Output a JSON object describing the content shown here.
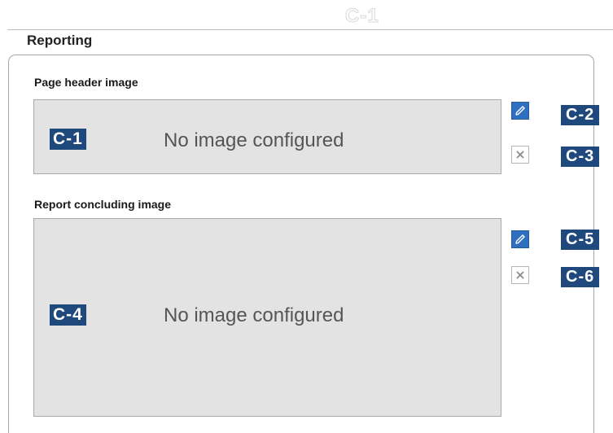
{
  "ghost_callout": "C-1",
  "section": {
    "title": "Reporting"
  },
  "page_header": {
    "label": "Page header image",
    "placeholder": "No image configured",
    "callouts": {
      "box": "C-1",
      "edit": "C-2",
      "remove": "C-3"
    }
  },
  "report_concluding": {
    "label": "Report concluding image",
    "placeholder": "No image configured",
    "callouts": {
      "box": "C-4",
      "edit": "C-5",
      "remove": "C-6"
    }
  },
  "icons": {
    "edit": "pencil-icon",
    "remove": "close-icon"
  },
  "colors": {
    "callout_bg": "#1f497d",
    "edit_button": "#2f6fbf",
    "image_box_bg": "#e3e3e3"
  }
}
